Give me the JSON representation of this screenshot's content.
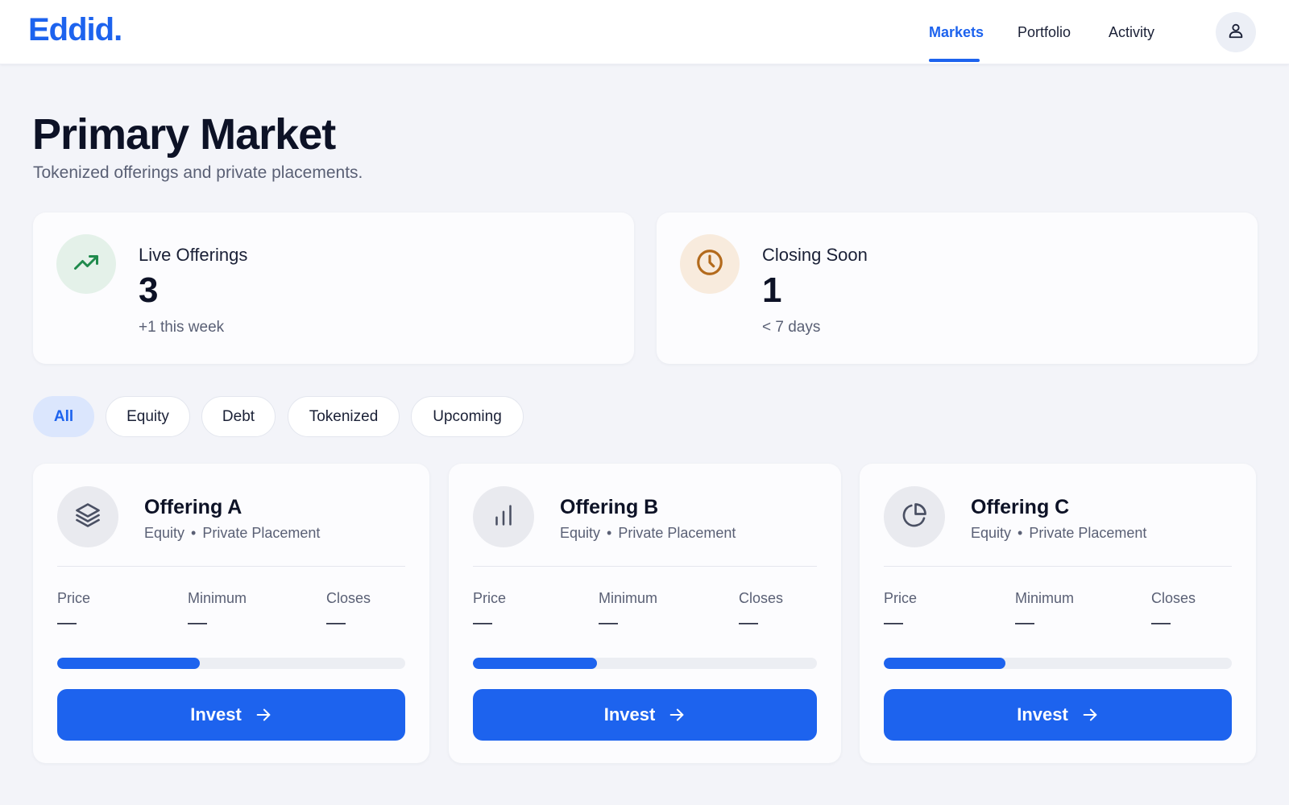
{
  "header": {
    "logo": "Eddid.",
    "nav": [
      {
        "label": "Markets",
        "active": true
      },
      {
        "label": "Portfolio",
        "active": false
      },
      {
        "label": "Activity",
        "active": false
      }
    ],
    "profile_icon": "user-icon"
  },
  "page": {
    "title": "Primary Market",
    "subtitle": "Tokenized offerings and private placements."
  },
  "stats": [
    {
      "icon": "trending-up-icon",
      "label": "Live Offerings",
      "value": "3",
      "note": "+1 this week",
      "icon_color": "#1f8a4c",
      "icon_bg": "#e4f1e9"
    },
    {
      "icon": "clock-icon",
      "label": "Closing Soon",
      "value": "1",
      "note": "< 7 days",
      "icon_color": "#b36a1c",
      "icon_bg": "#f8ebdd"
    }
  ],
  "filters": [
    {
      "label": "All",
      "active": true
    },
    {
      "label": "Equity",
      "active": false
    },
    {
      "label": "Debt",
      "active": false
    },
    {
      "label": "Tokenized",
      "active": false
    },
    {
      "label": "Upcoming",
      "active": false
    }
  ],
  "offerings": [
    {
      "icon": "layers-icon",
      "name": "Offering A",
      "type": "Equity",
      "category": "Private Placement",
      "dot": "•",
      "fields": {
        "price_label": "Price",
        "price": "—",
        "minimum_label": "Minimum",
        "minimum": "—",
        "closes_label": "Closes",
        "closes": "—"
      },
      "progress": 0.41,
      "button": "Invest"
    },
    {
      "icon": "bar-chart-icon",
      "name": "Offering B",
      "type": "Equity",
      "category": "Private Placement",
      "dot": "•",
      "fields": {
        "price_label": "Price",
        "price": "—",
        "minimum_label": "Minimum",
        "minimum": "—",
        "closes_label": "Closes",
        "closes": "—"
      },
      "progress": 0.36,
      "button": "Invest"
    },
    {
      "icon": "pie-chart-icon",
      "name": "Offering C",
      "type": "Equity",
      "category": "Private Placement",
      "dot": "•",
      "fields": {
        "price_label": "Price",
        "price": "—",
        "minimum_label": "Minimum",
        "minimum": "—",
        "closes_label": "Closes",
        "closes": "—"
      },
      "progress": 0.35,
      "button": "Invest"
    }
  ],
  "colors": {
    "accent": "#1d63ee",
    "background": "#f3f4f9",
    "active_chip_bg": "#dbe6fd"
  }
}
